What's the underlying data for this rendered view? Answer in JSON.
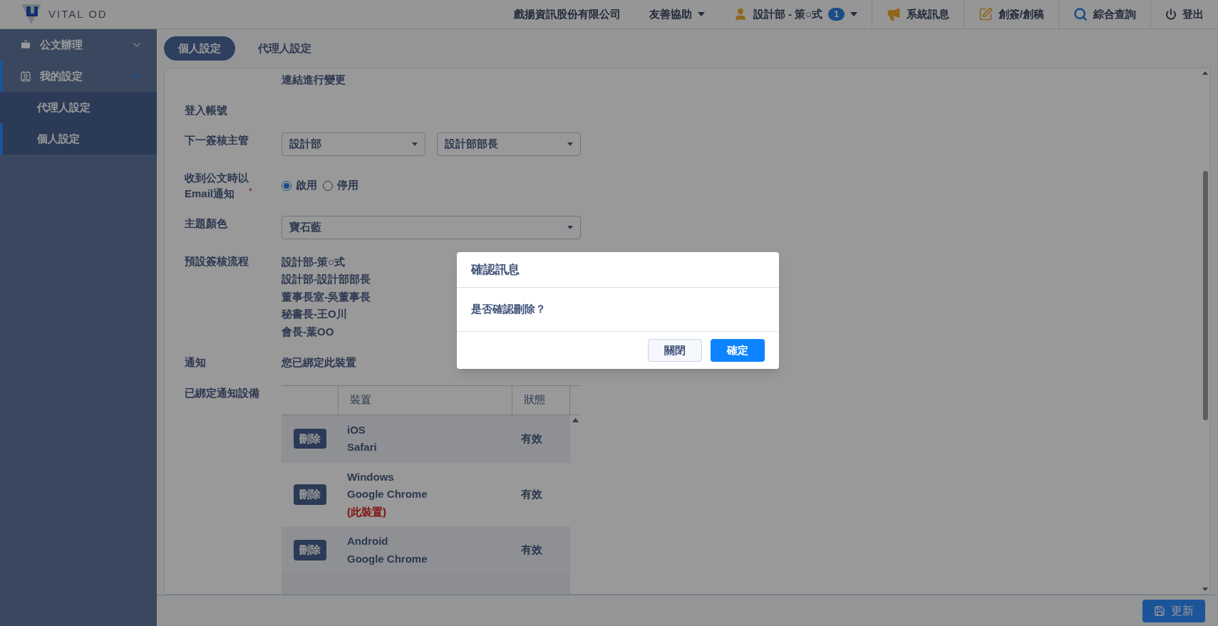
{
  "header": {
    "logo_text": "VITAL OD",
    "company": "戲揚資訊股份有限公司",
    "items": [
      {
        "kind": "dropdown",
        "label": "友善協助"
      },
      {
        "kind": "user",
        "label": "設計部 - 策○式",
        "badge": "1"
      },
      {
        "kind": "messages",
        "label": "系統訊息"
      },
      {
        "kind": "compose",
        "label": "創簽/創稿"
      },
      {
        "kind": "search",
        "label": "綜合查詢"
      },
      {
        "kind": "logout",
        "label": "登出"
      }
    ]
  },
  "sidebar": {
    "items": [
      {
        "label": "公文辦理",
        "kind": "briefcase",
        "expanded": false
      },
      {
        "label": "我的設定",
        "kind": "profile",
        "expanded": true,
        "children": [
          {
            "label": "代理人設定",
            "selected": false
          },
          {
            "label": "個人設定",
            "selected": true
          }
        ]
      }
    ]
  },
  "tabs": [
    {
      "label": "個人設定",
      "selected": true
    },
    {
      "label": "代理人設定",
      "selected": false
    }
  ],
  "form": {
    "rows": [
      {
        "kind": "note",
        "value": "連結進行變更"
      },
      {
        "kind": "text",
        "label": "登入帳號"
      },
      {
        "kind": "selects",
        "label": "下一簽核主管",
        "selects": [
          "設計部",
          "設計部部長"
        ]
      },
      {
        "kind": "radio",
        "label": "收到公文時以\nEmail通知",
        "required_mark": "*",
        "options": [
          {
            "label": "啟用",
            "selected": true
          },
          {
            "label": "停用",
            "selected": false
          }
        ]
      },
      {
        "kind": "select",
        "label": "主題顏色",
        "value": "寶石藍"
      },
      {
        "kind": "list",
        "label": "預設簽核流程",
        "lines": [
          "設計部-策○式",
          "設計部-設計部部長",
          "董事長室-吳董事長",
          "秘書長-王O川",
          "會長-葉OO"
        ]
      },
      {
        "kind": "text",
        "label": "通知",
        "value": "您已綁定此裝置"
      },
      {
        "kind": "table",
        "label": "已綁定通知設備",
        "columns": [
          "裝置",
          "狀態"
        ],
        "rows": [
          {
            "button": "刪除",
            "device_lines": [
              "iOS",
              "Safari"
            ],
            "status": "有效"
          },
          {
            "button": "刪除",
            "device_lines": [
              "Windows",
              "Google Chrome"
            ],
            "note": "(此裝置)",
            "status": "有效"
          },
          {
            "button": "刪除",
            "device_lines": [
              "Android",
              "Google Chrome"
            ],
            "status": "有效"
          }
        ]
      }
    ]
  },
  "footer": {
    "save_button": "更新"
  },
  "dialog": {
    "title": "確認訊息",
    "message": "是否確認刪除？",
    "buttons": [
      {
        "label": "關閉",
        "kind": "secondary"
      },
      {
        "label": "確定",
        "kind": "primary"
      }
    ]
  }
}
